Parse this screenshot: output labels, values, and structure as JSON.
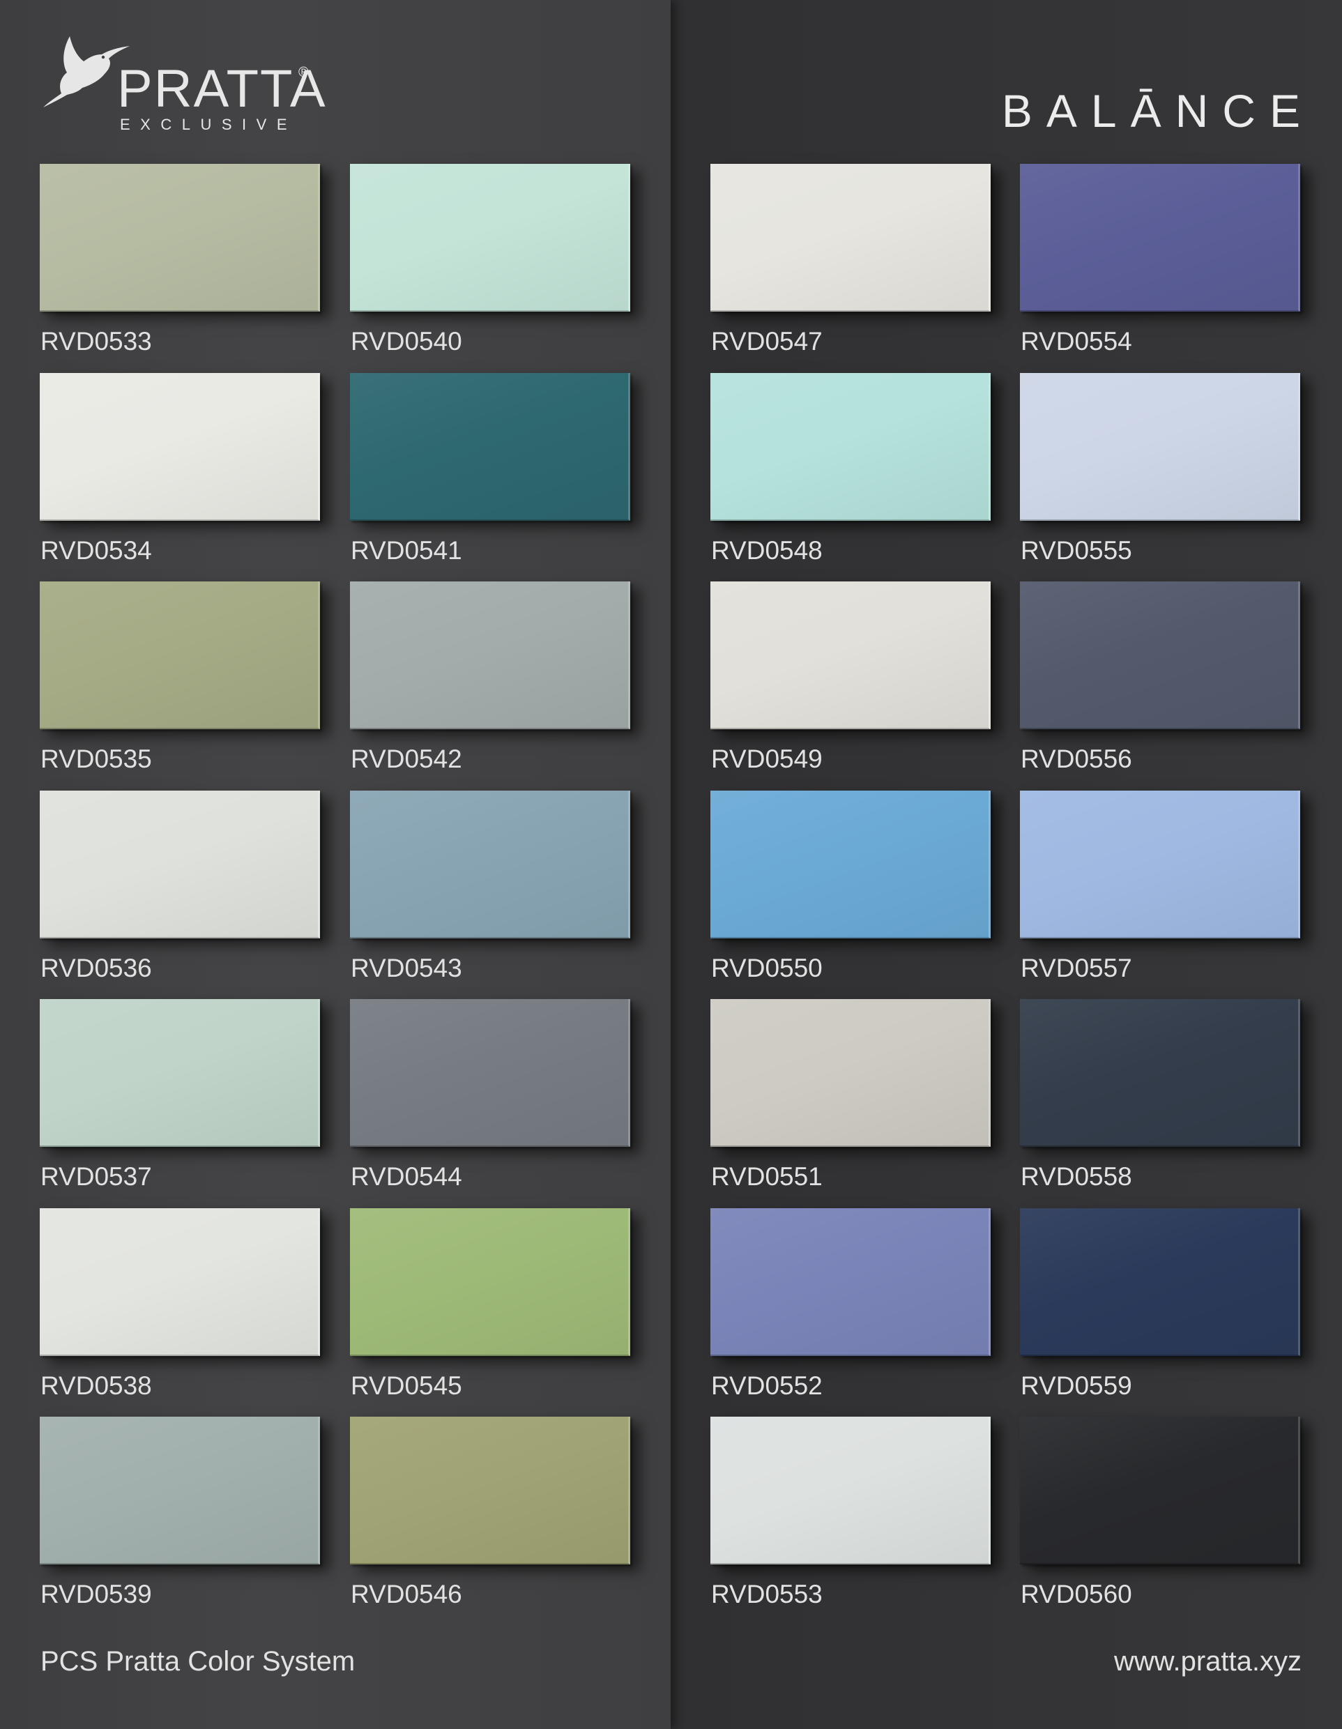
{
  "brand": {
    "name": "PRATTA",
    "registered_mark": "®",
    "tagline": "EXCLUSIVE",
    "logo_icon": "hummingbird-icon"
  },
  "collection": "BALĀNCE",
  "footer": {
    "system_name": "PCS Pratta Color System",
    "website": "www.pratta.xyz"
  },
  "swatches": [
    {
      "code": "RVD0533",
      "color": "#b6bca2"
    },
    {
      "code": "RVD0534",
      "color": "#e9eae4"
    },
    {
      "code": "RVD0535",
      "color": "#a5ab85"
    },
    {
      "code": "RVD0536",
      "color": "#dfe2dc"
    },
    {
      "code": "RVD0537",
      "color": "#c0d4c9"
    },
    {
      "code": "RVD0538",
      "color": "#e3e5e0"
    },
    {
      "code": "RVD0539",
      "color": "#a2b0ad"
    },
    {
      "code": "RVD0540",
      "color": "#c4e4d8"
    },
    {
      "code": "RVD0541",
      "color": "#2e6870"
    },
    {
      "code": "RVD0542",
      "color": "#a3acab"
    },
    {
      "code": "RVD0543",
      "color": "#88a4b3"
    },
    {
      "code": "RVD0544",
      "color": "#767c82"
    },
    {
      "code": "RVD0545",
      "color": "#9eba77"
    },
    {
      "code": "RVD0546",
      "color": "#a0a373"
    },
    {
      "code": "RVD0547",
      "color": "#e6e5df"
    },
    {
      "code": "RVD0548",
      "color": "#b5e2dc"
    },
    {
      "code": "RVD0549",
      "color": "#e2e0da"
    },
    {
      "code": "RVD0550",
      "color": "#6baad5"
    },
    {
      "code": "RVD0551",
      "color": "#cdcbc3"
    },
    {
      "code": "RVD0552",
      "color": "#7a84b8"
    },
    {
      "code": "RVD0553",
      "color": "#dde1e0"
    },
    {
      "code": "RVD0554",
      "color": "#5b5e98"
    },
    {
      "code": "RVD0555",
      "color": "#cdd6e7"
    },
    {
      "code": "RVD0556",
      "color": "#545a6c"
    },
    {
      "code": "RVD0557",
      "color": "#9fb9e2"
    },
    {
      "code": "RVD0558",
      "color": "#333d4b"
    },
    {
      "code": "RVD0559",
      "color": "#2b3a5a"
    },
    {
      "code": "RVD0560",
      "color": "#28292c"
    }
  ]
}
